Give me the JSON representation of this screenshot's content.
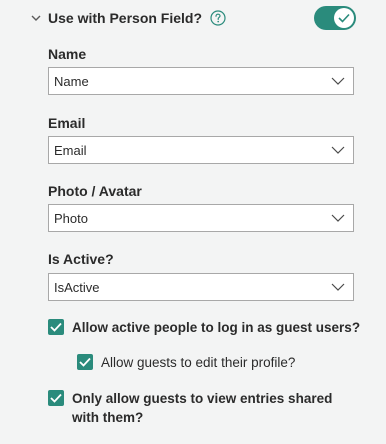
{
  "section": {
    "title": "Use with Person Field?",
    "help_icon": "question-circle-icon",
    "toggle_on": true,
    "accent_color": "#2a8b7c"
  },
  "fields": [
    {
      "label": "Name",
      "value": "Name"
    },
    {
      "label": "Email",
      "value": "Email"
    },
    {
      "label": "Photo / Avatar",
      "value": "Photo"
    },
    {
      "label": "Is Active?",
      "value": "IsActive"
    }
  ],
  "options": [
    {
      "label": "Allow active people to log in as guest users?",
      "checked": true
    },
    {
      "label": "Allow guests to edit their profile?",
      "checked": true
    },
    {
      "label": "Only allow guests to view entries shared with them?",
      "checked": true
    }
  ]
}
